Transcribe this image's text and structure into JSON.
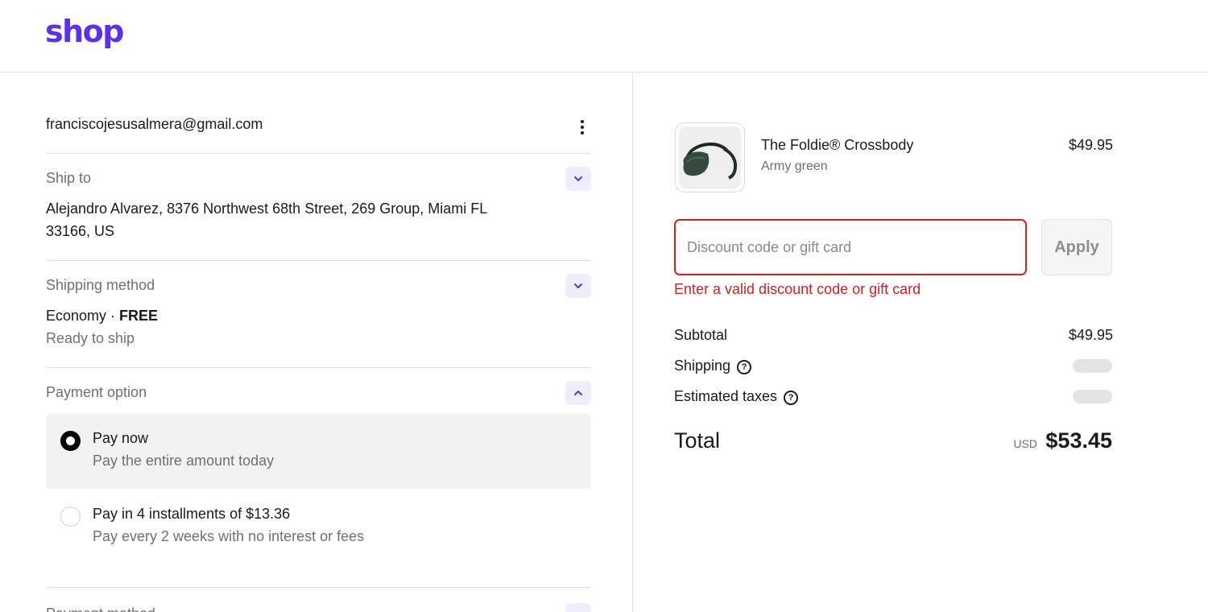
{
  "header": {
    "logo_text": "shop"
  },
  "contact": {
    "email": "franciscojesusalmera@gmail.com",
    "menu_icon": "kebab-menu-icon"
  },
  "ship_to": {
    "label": "Ship to",
    "address": "Alejandro Alvarez, 8376 Northwest 68th Street, 269 Group, Miami FL 33166, US",
    "expanded": false
  },
  "shipping_method": {
    "label": "Shipping method",
    "method": "Economy",
    "separator": " · ",
    "price": "FREE",
    "status": "Ready to ship",
    "expanded": false
  },
  "payment_option": {
    "label": "Payment option",
    "expanded": true,
    "options": [
      {
        "title": "Pay now",
        "description": "Pay the entire amount today",
        "selected": true
      },
      {
        "title": "Pay in 4 installments of $13.36",
        "description": "Pay every 2 weeks with no interest or fees",
        "selected": false
      }
    ]
  },
  "payment_method": {
    "label": "Payment method"
  },
  "order": {
    "product": {
      "name": "The Foldie® Crossbody",
      "variant": "Army green",
      "price": "$49.95"
    },
    "discount": {
      "placeholder": "Discount code or gift card",
      "value": "",
      "apply_label": "Apply",
      "error": "Enter a valid discount code or gift card"
    },
    "subtotal": {
      "label": "Subtotal",
      "value": "$49.95"
    },
    "shipping": {
      "label": "Shipping",
      "help_icon": "question-circle-icon"
    },
    "taxes": {
      "label": "Estimated taxes",
      "help_icon": "question-circle-icon"
    },
    "total": {
      "label": "Total",
      "currency": "USD",
      "value": "$53.45"
    }
  },
  "colors": {
    "brand": "#5a31f4",
    "error": "#dd1d1d",
    "muted_text": "#707070",
    "selected_bg": "#f2f2f2",
    "chevron_bg": "#f0edfd"
  }
}
